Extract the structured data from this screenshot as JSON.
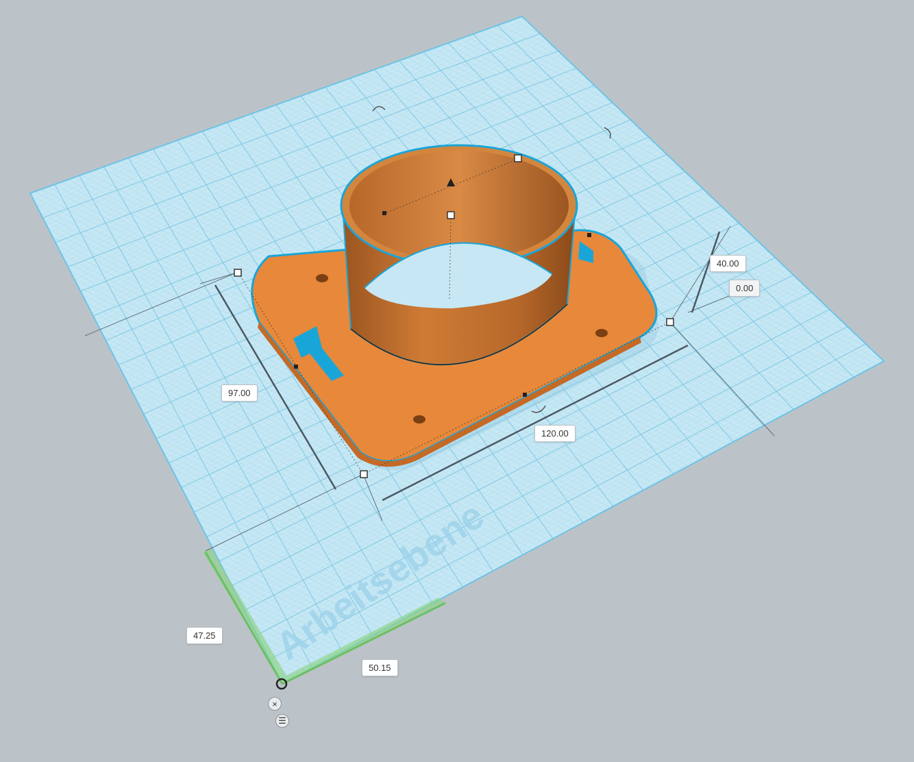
{
  "workplane": {
    "label": "Arbeitsebene",
    "grid_color": "#7ccbe8",
    "plane_color": "#c9e9f4"
  },
  "object": {
    "color": "#e8883a",
    "selection_color": "#1aa5d8"
  },
  "dimensions": {
    "width": "120.00",
    "depth": "97.00",
    "height": "40.00",
    "elevation": "0.00",
    "offset_y": "47.25",
    "offset_x": "50.15"
  },
  "controls": {
    "zoom_icon": "plus-icon",
    "menu_icon": "menu-icon"
  }
}
